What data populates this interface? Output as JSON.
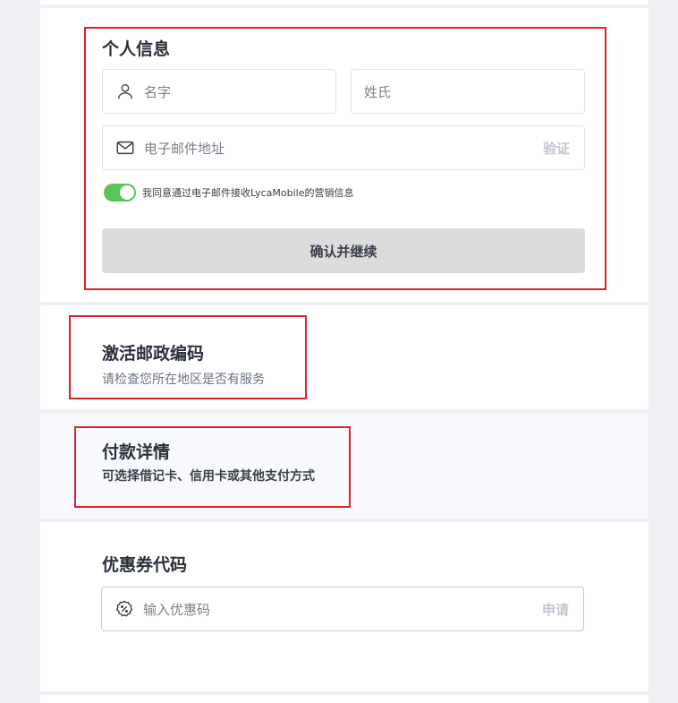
{
  "personal": {
    "title": "个人信息",
    "first_name_placeholder": "名字",
    "last_name_placeholder": "姓氏",
    "email_placeholder": "电子邮件地址",
    "verify_label": "验证",
    "consent_text": "我同意通过电子邮件接收LycaMobile的营销信息",
    "consent_on": true,
    "continue_label": "确认并继续",
    "user_icon": "user-icon",
    "mail_icon": "mail-icon"
  },
  "postcode": {
    "title": "激活邮政编码",
    "subtitle": "请检查您所在地区是否有服务"
  },
  "payment": {
    "title": "付款详情",
    "subtitle": "可选择借记卡、信用卡或其他支付方式"
  },
  "coupon": {
    "title": "优惠券代码",
    "placeholder": "输入优惠码",
    "apply_label": "申请",
    "discount_icon": "discount-badge-icon"
  },
  "colors": {
    "highlight": "#d9232e",
    "toggle_on": "#5ac35a",
    "button_bg": "#dcdcdc"
  }
}
